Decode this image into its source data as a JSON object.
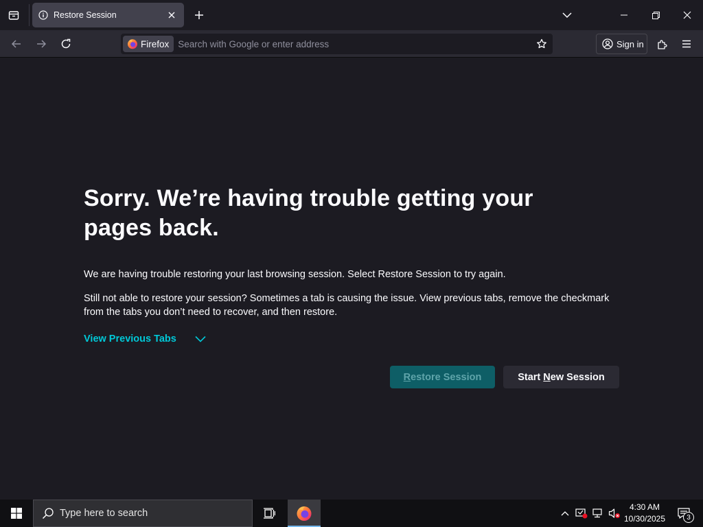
{
  "browser": {
    "tab": {
      "title": "Restore Session",
      "icon": "info-icon"
    },
    "urlbar": {
      "identity_label": "Firefox",
      "placeholder": "Search with Google or enter address"
    },
    "signin_label": "Sign in"
  },
  "page": {
    "title": "Sorry. We’re having trouble getting your pages back.",
    "paragraph1": "We are having trouble restoring your last browsing session. Select Restore Session to try again.",
    "paragraph2": "Still not able to restore your session? Sometimes a tab is causing the issue. View previous tabs, remove the checkmark from the tabs you don’t need to recover, and then restore.",
    "view_previous_tabs": "View Previous Tabs",
    "restore_button": {
      "pre": "",
      "accel": "R",
      "post": "estore Session"
    },
    "new_session_button": {
      "pre": "Start ",
      "accel": "N",
      "post": "ew Session"
    }
  },
  "taskbar": {
    "search_placeholder": "Type here to search",
    "clock_time": "4:30 AM",
    "clock_date": "10/30/2025",
    "notification_count": "3"
  },
  "colors": {
    "background": "#1c1b22",
    "toolbar": "#2b2a33",
    "accent_link": "#00c8d7",
    "restore_button_bg": "#0e5e66",
    "taskbar_bg": "#101013"
  }
}
